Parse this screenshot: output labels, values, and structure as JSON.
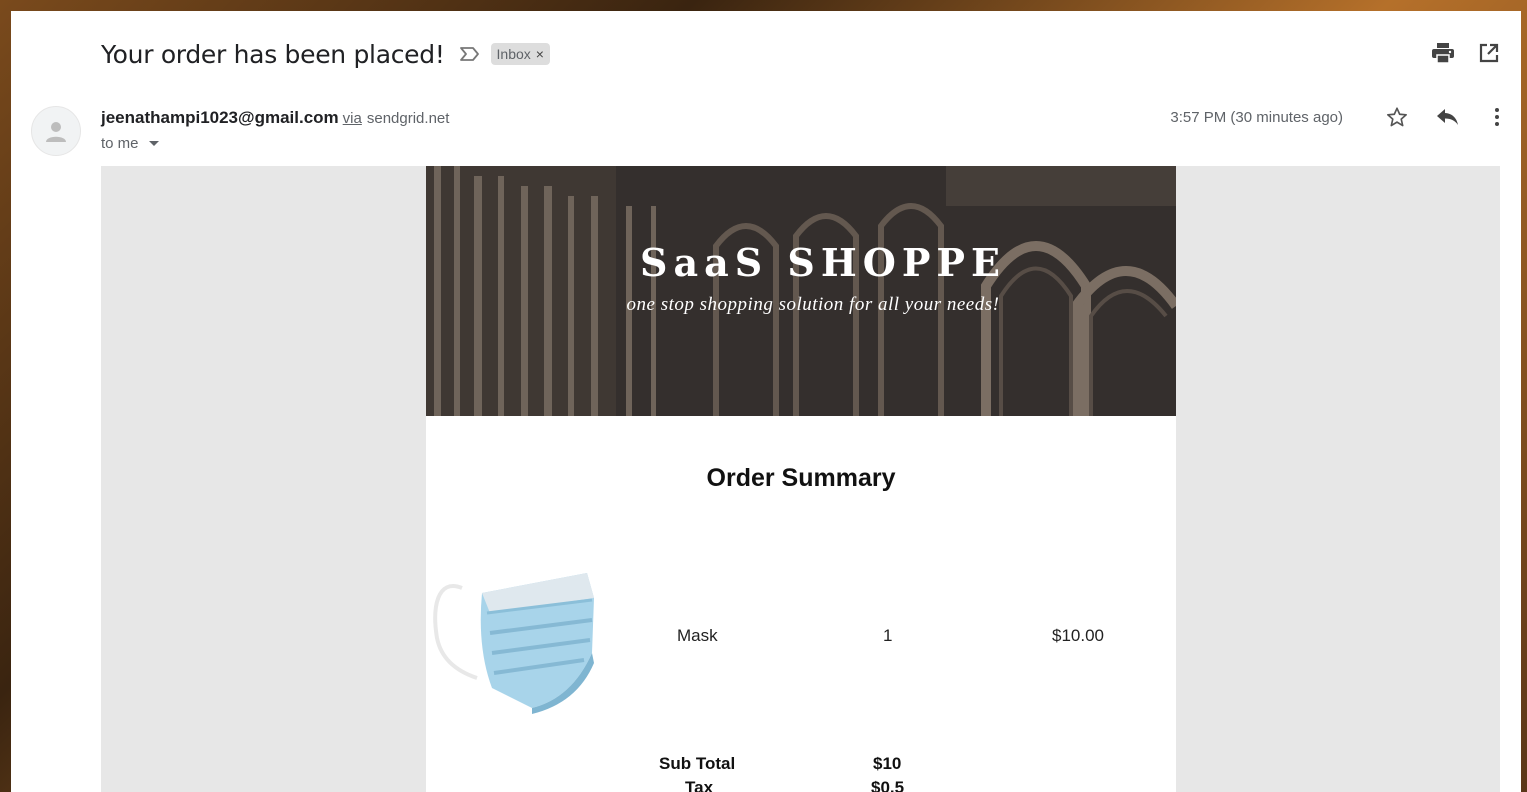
{
  "header": {
    "subject": "Your order has been placed!",
    "label": "Inbox",
    "label_remove": "×"
  },
  "sender": {
    "email": "jeenathampi1023@gmail.com",
    "via_label": "via",
    "via_domain": "sendgrid.net",
    "recipient": "to me",
    "timestamp": "3:57 PM (30 minutes ago)"
  },
  "icons": {
    "print": "print-icon",
    "open_new_window": "open-in-new-icon",
    "important": "important-marker-icon",
    "star": "star-icon",
    "reply": "reply-icon",
    "more": "more-vert-icon"
  },
  "email": {
    "brand": "SaaS SHOPPE",
    "tagline": "one stop shopping solution for all your needs!",
    "order_title": "Order Summary",
    "items": [
      {
        "name": "Mask",
        "qty": "1",
        "price": "$10.00"
      }
    ],
    "totals": [
      {
        "label": "Sub Total",
        "value": "$10"
      },
      {
        "label": "Tax",
        "value": "$0.5"
      }
    ]
  },
  "colors": {
    "frame_bg": "#ffffff",
    "body_bg": "#e7e7e7",
    "banner_bg": "#3a3532",
    "text_primary": "#202124",
    "text_secondary": "#5f6368",
    "chip_bg": "#dddddd"
  }
}
